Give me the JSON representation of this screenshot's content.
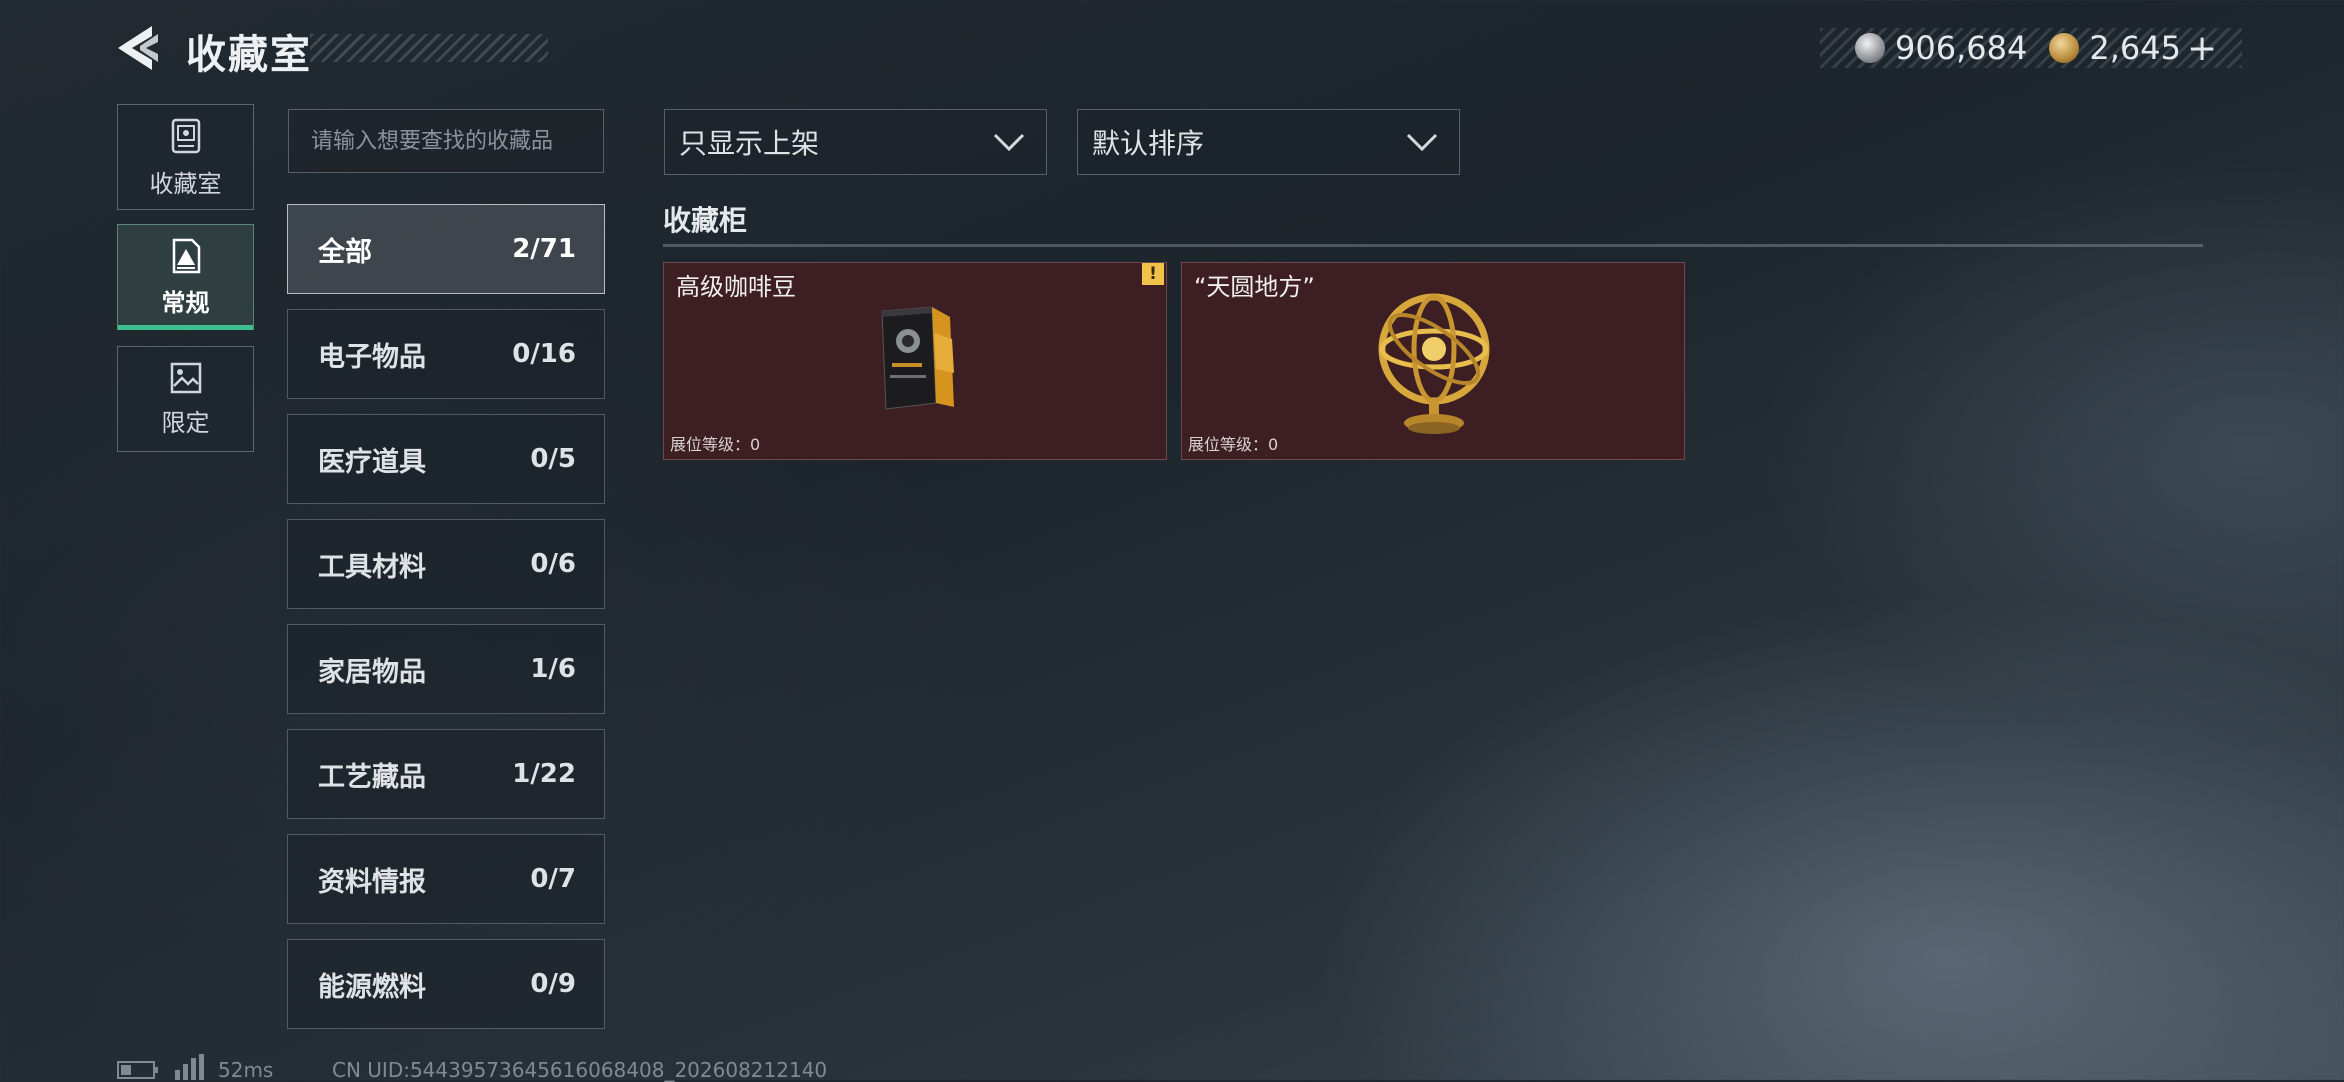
{
  "header": {
    "title": "收藏室",
    "back_icon": "back-arrow-icon",
    "currency": [
      {
        "icon": "silver-coin-icon",
        "value": "906,684"
      },
      {
        "icon": "gold-coin-icon",
        "value": "2,645"
      }
    ],
    "add_label": "+"
  },
  "mode_nav": [
    {
      "label": "收藏室",
      "icon": "collection-room-icon",
      "active": false
    },
    {
      "label": "常规",
      "icon": "regular-icon",
      "active": true
    },
    {
      "label": "限定",
      "icon": "limited-icon",
      "active": false
    }
  ],
  "search": {
    "placeholder": "请输入想要查找的收藏品",
    "value": ""
  },
  "categories": [
    {
      "name": "全部",
      "count": "2/71",
      "active": true
    },
    {
      "name": "电子物品",
      "count": "0/16"
    },
    {
      "name": "医疗道具",
      "count": "0/5"
    },
    {
      "name": "工具材料",
      "count": "0/6"
    },
    {
      "name": "家居物品",
      "count": "1/6"
    },
    {
      "name": "工艺藏品",
      "count": "1/22"
    },
    {
      "name": "资料情报",
      "count": "0/7"
    },
    {
      "name": "能源燃料",
      "count": "0/9"
    }
  ],
  "filters": {
    "display_filter": "只显示上架",
    "sort_order": "默认排序"
  },
  "section": {
    "title": "收藏柜"
  },
  "items": [
    {
      "name": "高级咖啡豆",
      "level_text": "展位等级：0",
      "badge": "!",
      "image_icon": "coffee-bag-icon"
    },
    {
      "name": "“天圆地方”",
      "level_text": "展位等级：0",
      "image_icon": "armillary-sphere-icon"
    }
  ],
  "status": {
    "ping": "52ms",
    "uid": "CN UID:54439573645616068408_202608212140"
  },
  "colors": {
    "accent_green": "#3fc08f",
    "card_bg": "#3d1e22",
    "warning_badge": "#f0c24a"
  }
}
